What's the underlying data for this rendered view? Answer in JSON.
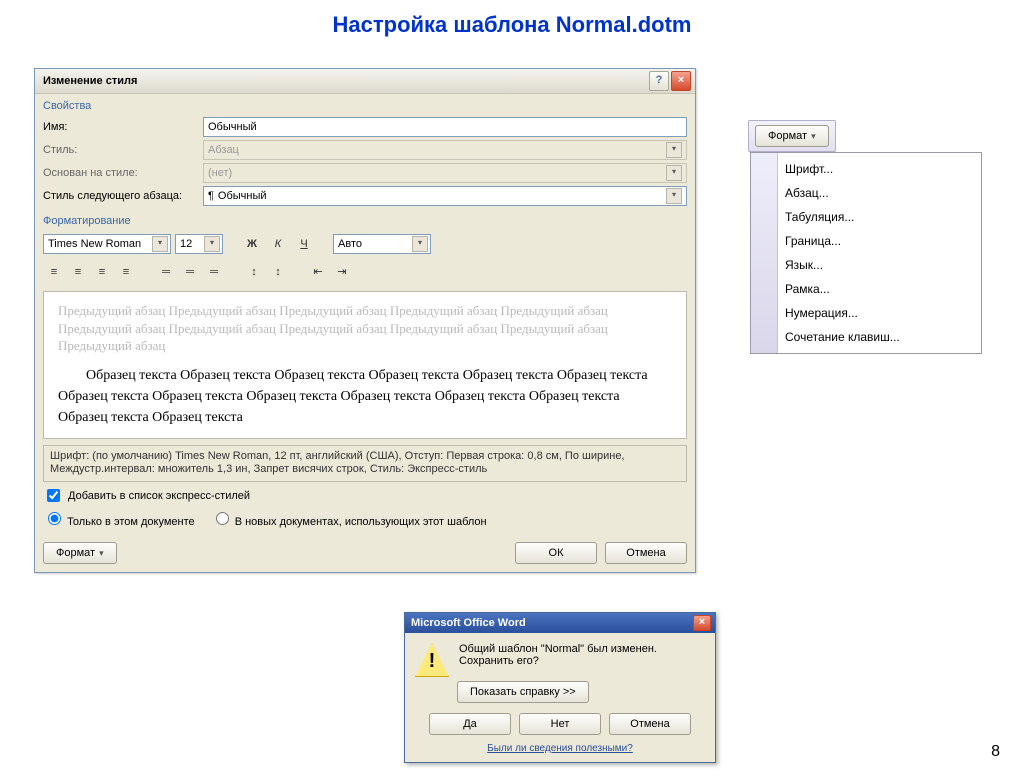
{
  "slide": {
    "title": "Настройка шаблона Normal.dotm",
    "page": "8"
  },
  "styleDialog": {
    "title": "Изменение стиля",
    "groups": {
      "props": "Свойства",
      "format": "Форматирование"
    },
    "labels": {
      "name": "Имя:",
      "styleType": "Стиль:",
      "basedOn": "Основан на стиле:",
      "nextStyle": "Стиль следующего абзаца:"
    },
    "values": {
      "name": "Обычный",
      "styleType": "Абзац",
      "basedOn": "(нет)",
      "nextStyle": "Обычный"
    },
    "font": {
      "name": "Times New Roman",
      "size": "12",
      "bold": "Ж",
      "italic": "К",
      "underline": "Ч",
      "color": "Авто"
    },
    "preview": {
      "prev": "Предыдущий абзац Предыдущий абзац Предыдущий абзац Предыдущий абзац Предыдущий абзац Предыдущий абзац Предыдущий абзац Предыдущий абзац Предыдущий абзац Предыдущий абзац Предыдущий абзац",
      "sample": "Образец текста Образец текста Образец текста Образец текста Образец текста Образец текста Образец текста Образец текста Образец текста Образец текста Образец текста Образец текста Образец текста Образец текста"
    },
    "description": "Шрифт: (по умолчанию) Times New Roman, 12 пт, английский (США), Отступ: Первая строка:  0,8 см, По ширине, Междустр.интервал: множитель 1,3 ин, Запрет висячих строк, Стиль: Экспресс-стиль",
    "checkbox": "Добавить в список экспресс-стилей",
    "radios": {
      "thisDoc": "Только в этом документе",
      "newDocs": "В новых документах, использующих этот шаблон"
    },
    "buttons": {
      "format": "Формат",
      "ok": "ОК",
      "cancel": "Отмена"
    }
  },
  "formatMenu": {
    "button": "Формат",
    "items": [
      "Шрифт...",
      "Абзац...",
      "Табуляция...",
      "Граница...",
      "Язык...",
      "Рамка...",
      "Нумерация...",
      "Сочетание клавиш..."
    ]
  },
  "msgBox": {
    "title": "Microsoft Office Word",
    "text": "Общий шаблон \"Normal\" был изменен.  Сохранить его?",
    "helpBtn": "Показать справку >>",
    "yes": "Да",
    "no": "Нет",
    "cancel": "Отмена",
    "link": "Были ли сведения полезными?"
  }
}
